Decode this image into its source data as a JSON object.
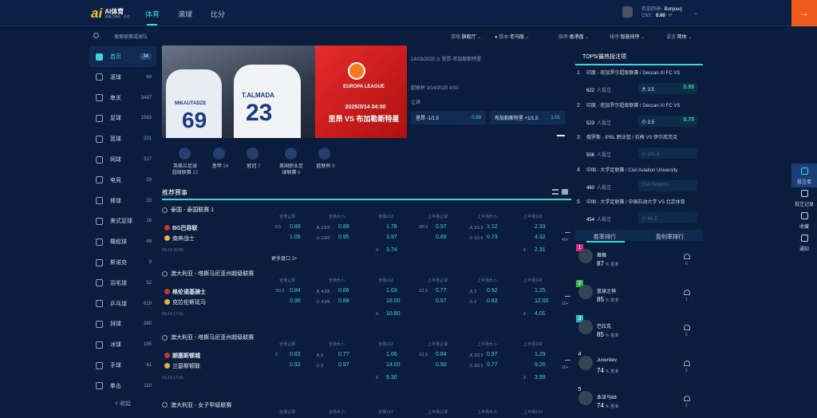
{
  "header": {
    "logo_mark": "ai",
    "logo_name": "AI体育",
    "logo_slogan": "赛事之精彩 · 尽在",
    "tabs": [
      {
        "label": "体育"
      },
      {
        "label": "滚球"
      },
      {
        "label": "比分"
      }
    ],
    "greeting": "欢迎回来!",
    "username": "Bonjourj",
    "currency": "CNY:",
    "balance": "0.00"
  },
  "toolbar": {
    "search_placeholder": "搜索联赛或球队",
    "game_label": "游戏:",
    "game_value": "旗舰厅",
    "version_label": "版本:",
    "version_value": "老马版",
    "odds_label": "赔率:",
    "odds_value": "香港盘",
    "sort_label": "排序:",
    "sort_value": "智能排序",
    "lang_label": "语言:",
    "lang_value": "简体"
  },
  "sidebar": {
    "items": [
      {
        "label": "首页",
        "count": "34"
      },
      {
        "label": "滚球",
        "count": "60"
      },
      {
        "label": "串关",
        "count": "3487"
      },
      {
        "label": "足球",
        "count": "1563"
      },
      {
        "label": "篮球",
        "count": "231"
      },
      {
        "label": "网球",
        "count": "317"
      },
      {
        "label": "电竞",
        "count": "29"
      },
      {
        "label": "棒球",
        "count": "33"
      },
      {
        "label": "美式足球",
        "count": "16"
      },
      {
        "label": "橄榄球",
        "count": "48"
      },
      {
        "label": "斯诺克",
        "count": "9"
      },
      {
        "label": "羽毛球",
        "count": "52"
      },
      {
        "label": "乒乓球",
        "count": "619"
      },
      {
        "label": "排球",
        "count": "260"
      },
      {
        "label": "冰球",
        "count": "195"
      },
      {
        "label": "手球",
        "count": "41"
      },
      {
        "label": "拳击",
        "count": "110"
      }
    ],
    "collapse": "< 收起"
  },
  "banner": {
    "name1": "MIKAUTADZE",
    "num1": "69",
    "name2": "T.ALMADA",
    "num2": "23",
    "el_title": "EUROPA LEAGUE",
    "date": "2025/3/14 04:00",
    "vs": "里昂 VS 布加勒斯特星"
  },
  "featured": {
    "date": "14/03/2025",
    "venue": "里昂-布加勒斯特星",
    "kickoff": "欧联杯 3/14/2025 4:00",
    "market": "让球",
    "bet1_label": "里昂 -1/1.5",
    "bet1_odd": "0.89",
    "bet2_label": "布加勒斯特星 +1/1.5",
    "bet2_odd": "1.01"
  },
  "leagues": [
    {
      "name": "英格兰足球超级联赛",
      "count": "22"
    },
    {
      "name": "意甲",
      "count": "24"
    },
    {
      "name": "欧冠",
      "count": "7"
    },
    {
      "name": "美国职业足球联赛",
      "count": "8"
    },
    {
      "name": "欧联杯",
      "count": "9"
    }
  ],
  "section": {
    "title": "推荐赛事"
  },
  "col_headers": [
    "全场让球",
    "全场大小",
    "全场1X2",
    "上半场让球",
    "上半场大小",
    "上半场1X2"
  ],
  "matches": [
    {
      "competition": "泰国 - 泰国联赛 1",
      "home": "BG巴吞联",
      "away": "南奔战士",
      "time": "03-14 20:00",
      "more": "更多盘口 2+",
      "hcp": "0.5",
      "home_h": "0.80",
      "away_h": "1.06",
      "ou_h": "大 2.5/3",
      "ou_a": "小 2.5/3",
      "ou_hv": "0.89",
      "ou_av": "0.95",
      "x1_h": "1.78",
      "x1_a": "3.97",
      "x_label": "X",
      "x_val": "3.74",
      "hhcp": "0/0.5",
      "hh": "0.97",
      "ha": "0.89",
      "hou_h": "大 1/1.5",
      "hou_a": "小 1/1.5",
      "hou_hv": "1.12",
      "hou_av": "0.73",
      "hx_h": "2.33",
      "hx_a": "4.32",
      "hx_label": "X",
      "hx_val": "2.31",
      "mnum": "40+"
    },
    {
      "competition": "澳大利亚 - 塔斯马尼亚州超级联赛",
      "home": "格伦诺基骑士",
      "away": "克拉伦斯延马",
      "time": "03-14 17:15",
      "hcp": "3/3.5",
      "home_h": "0.84",
      "away_h": "0.90",
      "ou_h": "大 4.5/5",
      "ou_a": "小 4.5/5",
      "ou_hv": "0.86",
      "ou_av": "0.88",
      "x1_h": "1.03",
      "x1_a": "18.00",
      "x_label": "X",
      "x_val": "10.80",
      "hhcp": "1/1.5",
      "hh": "0.77",
      "ha": "0.97",
      "hou_h": "大 2",
      "hou_a": "小 2",
      "hou_hv": "0.92",
      "hou_av": "0.82",
      "hx_h": "1.25",
      "hx_a": "12.00",
      "hx_label": "X",
      "hx_val": "4.01",
      "mnum": "16+"
    },
    {
      "competition": "澳大利亚 - 塔斯马尼亚州超级联赛",
      "home": "朗塞斯顿城",
      "away": "兰瑟斯顿联",
      "time": "03-14 17:15",
      "hcp": "3",
      "home_h": "0.82",
      "away_h": "0.92",
      "ou_h": "大 5",
      "ou_a": "小 5",
      "ou_hv": "0.77",
      "ou_av": "0.97",
      "x1_h": "1.06",
      "x1_a": "14.00",
      "x_label": "X",
      "x_val": "9.30",
      "hhcp": "1/1.5",
      "hh": "0.84",
      "ha": "0.90",
      "hou_h": "大 2/2.5",
      "hou_a": "小 2/2.5",
      "hou_hv": "0.97",
      "hou_av": "0.77",
      "hx_h": "1.29",
      "hx_a": "9.20",
      "hx_label": "X",
      "hx_val": "3.99",
      "mnum": "16+"
    }
  ],
  "competition4": "澳大利亚 - 女子甲级联赛",
  "right": {
    "title": "TOP5/最热投注项",
    "bettors_label": "人投注",
    "hot": [
      {
        "no": "1",
        "league": "印度 - 班加罗尔超级联赛 / Deccan XI FC VS",
        "count": "622",
        "sel": "大 3.5",
        "odd": "0.99"
      },
      {
        "no": "2",
        "league": "印度 - 班加罗尔超级联赛 / Deccan XI FC VS",
        "count": "523",
        "sel": "小 3.5",
        "odd": "0.75"
      },
      {
        "no": "3",
        "league": "俄罗斯 - IPBL 职业篮 / 石梅 VS 伊尔库茨克",
        "count": "506",
        "sel": "小 241.5",
        "odd": ""
      },
      {
        "no": "4",
        "league": "中国 - 大学足联赛 / Civil Aviation University",
        "count": "460",
        "sel": "Civil Aviation",
        "odd": ""
      },
      {
        "no": "5",
        "league": "中国 - 大学足联赛 / 中国石油大学 VS 北京体育",
        "count": "454",
        "sel": "小 84.5",
        "odd": ""
      }
    ],
    "tab1": "胜率排行",
    "tab2": "盈利率排行",
    "win_label": "胜率",
    "ranks": [
      {
        "no": "1",
        "name": "薇薇",
        "pct": "87",
        "likes": "6",
        "color": "#d22b8a"
      },
      {
        "no": "2",
        "name": "篮球之神",
        "pct": "85",
        "likes": "1",
        "color": "#2fb44a"
      },
      {
        "no": "3",
        "name": "巴拉克",
        "pct": "85",
        "likes": "6",
        "color": "#22b4c4"
      },
      {
        "no": "4",
        "name": "Juvenilev",
        "pct": "74",
        "likes": "2",
        "color": ""
      },
      {
        "no": "5",
        "name": "本泽马68",
        "pct": "74",
        "likes": "2",
        "color": ""
      }
    ]
  },
  "dock": {
    "items": [
      {
        "label": "投注单"
      },
      {
        "label": "投注记录"
      },
      {
        "label": "收藏"
      },
      {
        "label": "通知"
      }
    ]
  }
}
